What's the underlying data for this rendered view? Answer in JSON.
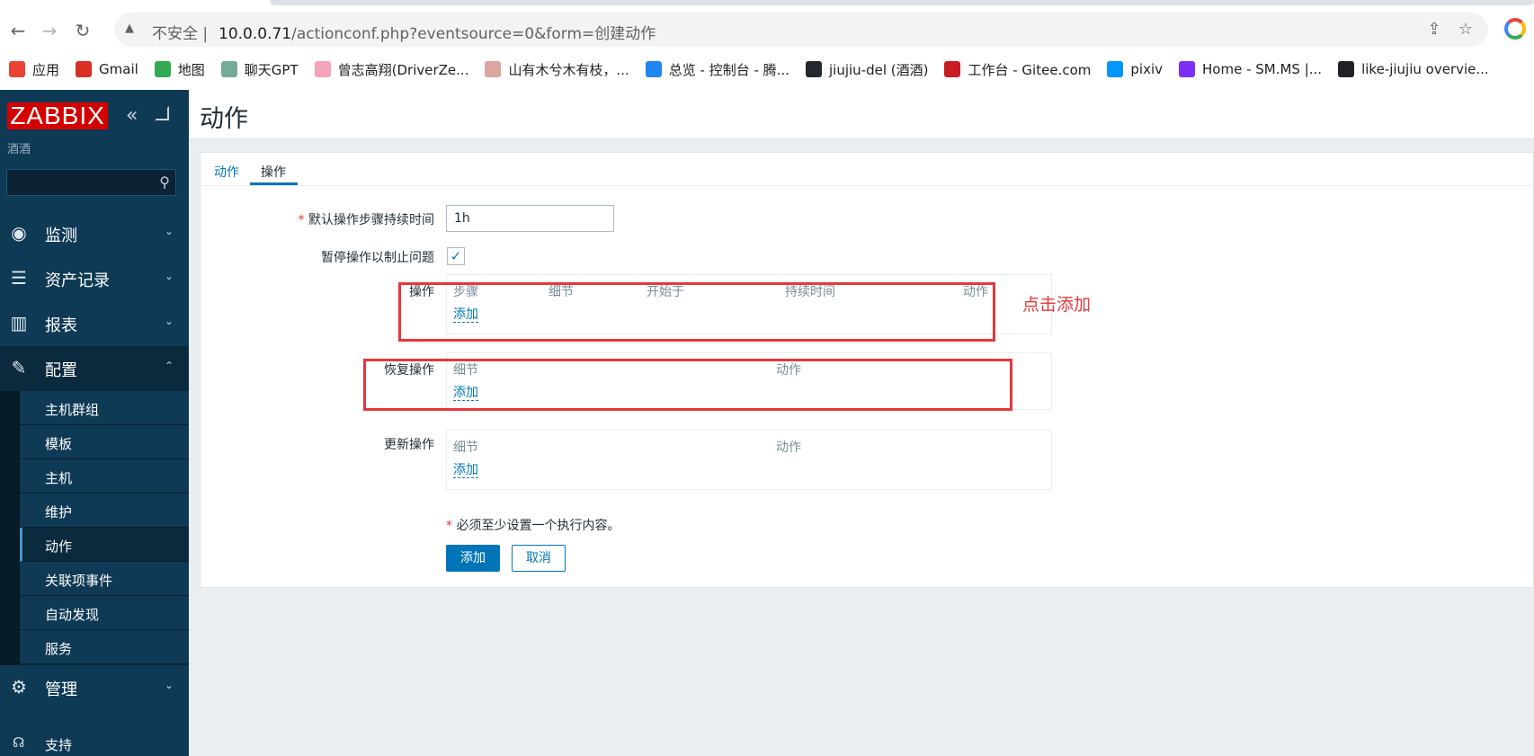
{
  "browser": {
    "security_label": "不安全 |",
    "url_host": "10.0.0.71",
    "url_path": "/actionconf.php?eventsource=0&form=创建动作",
    "bookmarks": [
      {
        "label": "应用",
        "icon": "apps-grid-icon",
        "color": "#ea4335"
      },
      {
        "label": "Gmail",
        "icon": "gmail-icon",
        "color": "#d93025"
      },
      {
        "label": "地图",
        "icon": "maps-pin-icon",
        "color": "#34a853"
      },
      {
        "label": "聊天GPT",
        "icon": "chatgpt-icon",
        "color": "#74aa9c"
      },
      {
        "label": "曾志高翔(DriverZe...",
        "icon": "flower-icon",
        "color": "#f5a3b7"
      },
      {
        "label": "山有木兮木有枝，...",
        "icon": "avatar-icon",
        "color": "#d9a6a0"
      },
      {
        "label": "总览 - 控制台 - 腾...",
        "icon": "cloud-icon",
        "color": "#1d86f0"
      },
      {
        "label": "jiujiu-del (酒酒)",
        "icon": "github-icon",
        "color": "#24292f"
      },
      {
        "label": "工作台 - Gitee.com",
        "icon": "gitee-icon",
        "color": "#c71d23"
      },
      {
        "label": "pixiv",
        "icon": "pixiv-icon",
        "color": "#0096fa"
      },
      {
        "label": "Home - SM.MS |...",
        "icon": "smms-icon",
        "color": "#7b2ff7"
      },
      {
        "label": "like-jiujiu overvie...",
        "icon": "leaf-icon",
        "color": "#202124"
      }
    ]
  },
  "sidebar": {
    "logo": "ZABBIX",
    "server_name": "酒酒",
    "menu": {
      "monitoring": "监测",
      "inventory": "资产记录",
      "reports": "报表",
      "configuration": "配置",
      "administration": "管理",
      "support": "支持"
    },
    "config_items": [
      "主机群组",
      "模板",
      "主机",
      "维护",
      "动作",
      "关联项事件",
      "自动发现",
      "服务"
    ]
  },
  "page": {
    "title": "动作",
    "tabs": [
      "动作",
      "操作"
    ],
    "form": {
      "duration_label": "默认操作步骤持续时间",
      "duration_value": "1h",
      "pause_label": "暂停操作以制止问题",
      "pause_checked": true,
      "operations_label": "操作",
      "operations_columns": [
        "步骤",
        "细节",
        "开始于",
        "持续时间",
        "动作"
      ],
      "recovery_label": "恢复操作",
      "recovery_columns": [
        "细节",
        "动作"
      ],
      "update_label": "更新操作",
      "update_columns": [
        "细节",
        "动作"
      ],
      "add_link": "添加",
      "required_note": "必须至少设置一个执行内容。",
      "submit_button": "添加",
      "cancel_button": "取消"
    },
    "annotation": "点击添加"
  },
  "colors": {
    "sidebar_bg": "#0e3a55",
    "accent": "#0275b8",
    "logo_red": "#d40000",
    "annotation_red": "#e4383a"
  }
}
